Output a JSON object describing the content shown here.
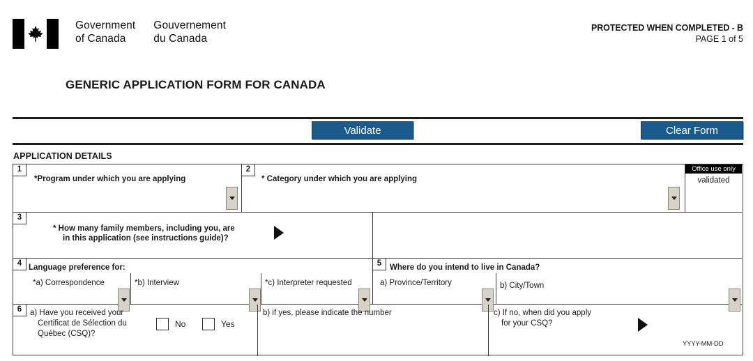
{
  "header": {
    "wordmark_en_line1": "Government",
    "wordmark_en_line2": "of Canada",
    "wordmark_fr_line1": "Gouvernement",
    "wordmark_fr_line2": "du Canada",
    "protected_marking": "PROTECTED WHEN COMPLETED - B",
    "page_indicator": "PAGE 1 of 5",
    "form_title": "GENERIC APPLICATION FORM FOR CANADA"
  },
  "toolbar": {
    "validate_label": "Validate",
    "clear_label": "Clear Form",
    "button_color": "#1a5a8d"
  },
  "section": {
    "title": "APPLICATION DETAILS"
  },
  "fields": {
    "q1": {
      "number": "1",
      "label": "*Program under which you are applying",
      "value": ""
    },
    "q2": {
      "number": "2",
      "label": "* Category under which you are applying",
      "value": ""
    },
    "office": {
      "header": "Office use only",
      "value": "validated"
    },
    "q3": {
      "number": "3",
      "label_line1": "* How many family members, including you, are",
      "label_line2": "in this application (see instructions guide)?",
      "value": ""
    },
    "q4": {
      "number": "4",
      "label": "Language preference for:",
      "a_label": "*a) Correspondence",
      "a_value": "",
      "b_label": "*b) Interview",
      "b_value": "",
      "c_label": "*c) Interpreter requested",
      "c_value": ""
    },
    "q5": {
      "number": "5",
      "label": "Where do you intend to live in Canada?",
      "a_label": "a) Province/Territory",
      "a_value": "",
      "b_label": "b) City/Town",
      "b_value": ""
    },
    "q6": {
      "number": "6",
      "a_label_line1": "a) Have you received your",
      "a_label_line2": "Certificat de Sélection du",
      "a_label_line3": "Québec (CSQ)?",
      "no_label": "No",
      "yes_label": "Yes",
      "b_label": "b) if yes, please indicate the number",
      "b_value": "",
      "c_label_line1": "c) If no, when did you apply",
      "c_label_line2": "for your CSQ?",
      "c_value": "",
      "date_hint": "YYYY-MM-DD"
    }
  }
}
